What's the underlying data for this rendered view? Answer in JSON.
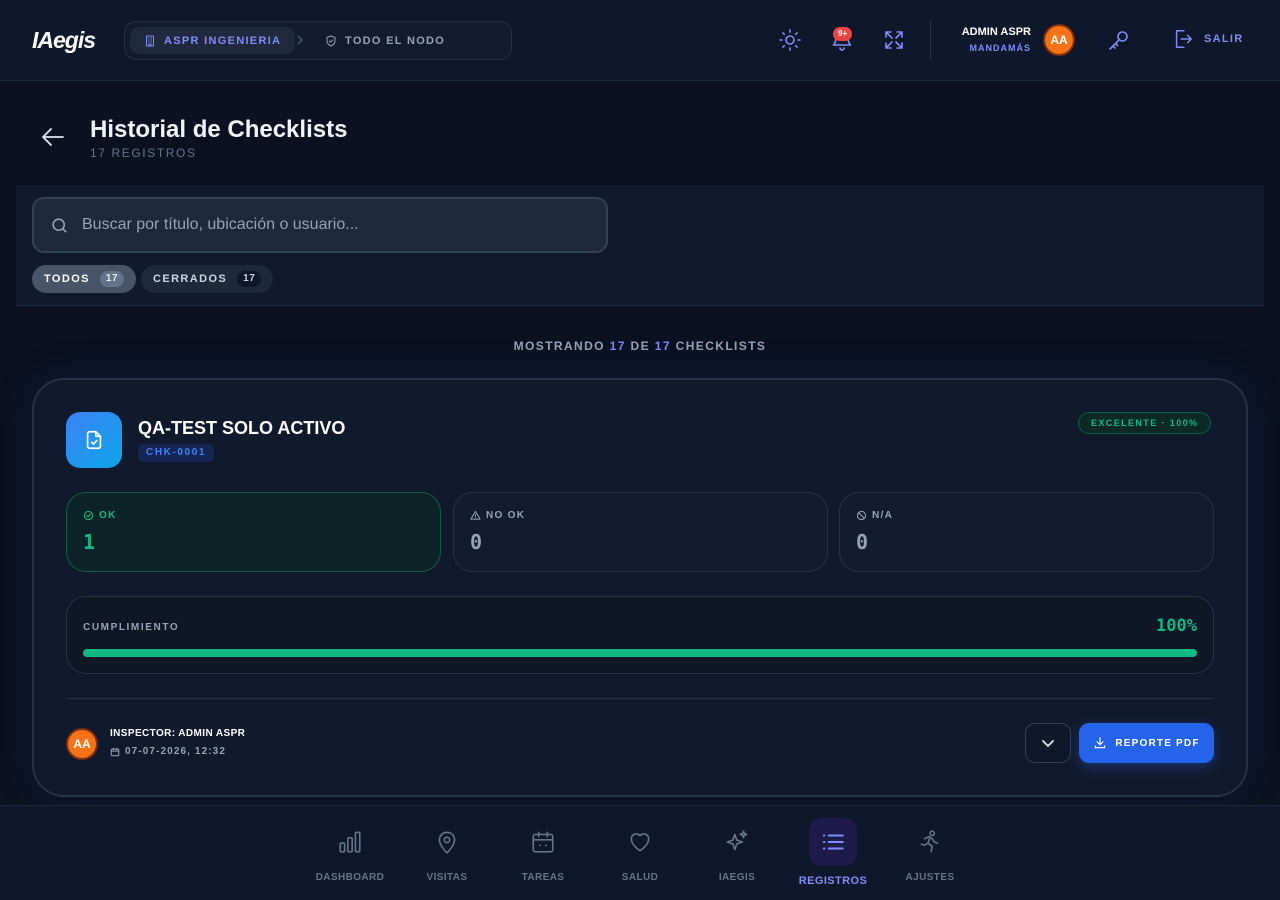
{
  "app": {
    "logo": "IAegis"
  },
  "header": {
    "breadcrumb": {
      "organization": "ASPR INGENIERIA",
      "node": "TODO EL NODO"
    },
    "notifications_badge": "9+",
    "user": {
      "name": "ADMIN ASPR",
      "role": "MANDAMÁS",
      "initials": "AA"
    },
    "logout_label": "SALIR"
  },
  "page": {
    "title": "Historial de Checklists",
    "subtitle": "17 REGISTROS"
  },
  "search": {
    "placeholder": "Buscar por título, ubicación o usuario...",
    "value": ""
  },
  "filters": [
    {
      "label": "TODOS",
      "count": "17",
      "active": true
    },
    {
      "label": "CERRADOS",
      "count": "17",
      "active": false
    }
  ],
  "summary": {
    "prefix": "MOSTRANDO",
    "shown": "17",
    "connector": "DE",
    "total": "17",
    "suffix": "CHECKLISTS"
  },
  "checklist": {
    "title": "QA-TEST SOLO ACTIVO",
    "code": "CHK-0001",
    "grade_label": "EXCELENTE · 100%",
    "stats": {
      "ok": {
        "label": "OK",
        "value": "1"
      },
      "not_ok": {
        "label": "NO OK",
        "value": "0"
      },
      "na": {
        "label": "N/A",
        "value": "0"
      }
    },
    "compliance": {
      "label": "CUMPLIMIENTO",
      "value_label": "100%",
      "percent": 100
    },
    "inspector": {
      "label": "INSPECTOR: ADMIN ASPR",
      "initials": "AA",
      "datetime": "07-07-2026, 12:32"
    },
    "pdf_button_label": "REPORTE PDF"
  },
  "nav": {
    "items": [
      {
        "label": "DASHBOARD",
        "icon": "bar-chart-icon"
      },
      {
        "label": "VISITAS",
        "icon": "map-pin-icon"
      },
      {
        "label": "TAREAS",
        "icon": "calendar-icon"
      },
      {
        "label": "SALUD",
        "icon": "heart-icon"
      },
      {
        "label": "IAEGIS",
        "icon": "sparkles-icon"
      },
      {
        "label": "REGISTROS",
        "icon": "list-icon"
      },
      {
        "label": "AJUSTES",
        "icon": "running-person-icon"
      }
    ],
    "active_index": 5
  },
  "colors": {
    "background": "#0b1120",
    "accent": "#818cf8",
    "success": "#10b981",
    "primary_button": "#2563eb",
    "avatar": "#f97316",
    "badge": "#ef4444"
  }
}
